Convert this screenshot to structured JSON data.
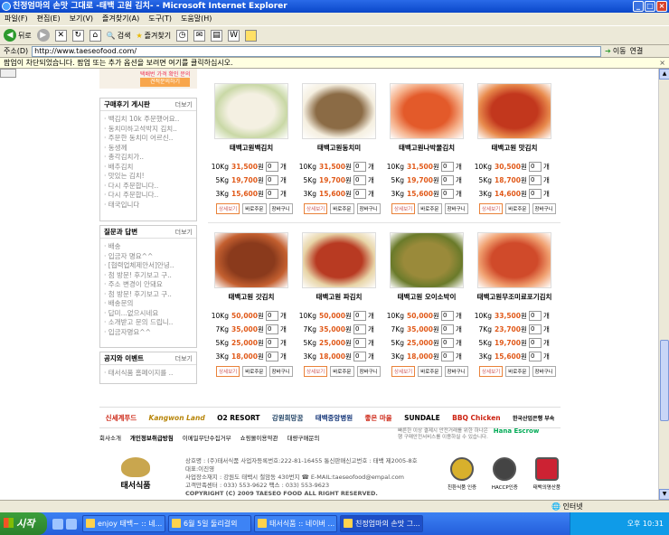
{
  "window": {
    "title": "친정엄마의 손맛 그대로 -태백 고원 김치- - Microsoft Internet Explorer"
  },
  "menu": [
    "파일(F)",
    "편집(E)",
    "보기(V)",
    "즐겨찾기(A)",
    "도구(T)",
    "도움말(H)"
  ],
  "toolbar": {
    "back": "뒤로",
    "search": "검색",
    "favorites": "즐겨찾기"
  },
  "address": {
    "label": "주소(D)",
    "url": "http://www.taeseofood.com/",
    "go": "이동",
    "links": "연결"
  },
  "popup": {
    "message": "팝업이 차단되었습니다. 팝업 또는 추가 옵션을 보려면 여기를 클릭하십시오."
  },
  "banner": {
    "button": "견적문의하기",
    "caption": "택배번 가격 확인 문의"
  },
  "reviews": {
    "title": "구매후기 게시판",
    "more": "더보기",
    "items": [
      "백김치 10k 주문했어요..",
      "동치미하고석박지 김치..",
      "주문한 동치미 어르신..",
      "동생께",
      "총각김치가..",
      "배추김치",
      "맛있는 김치!",
      "다시 주문합니다..",
      "다시 주문합니다..",
      "태국입니다"
    ]
  },
  "qna": {
    "title": "질문과 답변",
    "more": "더보기",
    "items": [
      "배송",
      "입금자 명요^^",
      "[협력업체제안서]안녕..",
      "첨 방문! 후기보고 구..",
      "주소 변경이 안돼요",
      "첨 방문! 후기보고 구..",
      "배송문의",
      "답미...없으시네요",
      "소개받고 문의 드립니..",
      "입금자명요^^"
    ]
  },
  "notice": {
    "title": "공지와 이벤트",
    "more": "더보기",
    "items": [
      "태서식품 홈페이지를 .."
    ]
  },
  "products_row1": [
    {
      "name": "태백고원백김치",
      "prices": [
        {
          "size": "10Kg",
          "price": "31,500"
        },
        {
          "size": "5Kg",
          "price": "19,700"
        },
        {
          "size": "3Kg",
          "price": "15,600"
        }
      ]
    },
    {
      "name": "태백고원동치미",
      "prices": [
        {
          "size": "10Kg",
          "price": "31,500"
        },
        {
          "size": "5Kg",
          "price": "19,700"
        },
        {
          "size": "3Kg",
          "price": "15,600"
        }
      ]
    },
    {
      "name": "태백고원나박물김치",
      "prices": [
        {
          "size": "10Kg",
          "price": "31,500"
        },
        {
          "size": "5Kg",
          "price": "19,700"
        },
        {
          "size": "3Kg",
          "price": "15,600"
        }
      ]
    },
    {
      "name": "태백고원 맛김치",
      "prices": [
        {
          "size": "10Kg",
          "price": "30,500"
        },
        {
          "size": "5Kg",
          "price": "18,700"
        },
        {
          "size": "3Kg",
          "price": "14,600"
        }
      ]
    }
  ],
  "products_row2": [
    {
      "name": "태백고원 갓김치",
      "prices": [
        {
          "size": "10Kg",
          "price": "50,000"
        },
        {
          "size": "7Kg",
          "price": "35,000"
        },
        {
          "size": "5Kg",
          "price": "25,000"
        },
        {
          "size": "3Kg",
          "price": "18,000"
        }
      ]
    },
    {
      "name": "태백고원 파김치",
      "prices": [
        {
          "size": "10Kg",
          "price": "50,000"
        },
        {
          "size": "7Kg",
          "price": "35,000"
        },
        {
          "size": "5Kg",
          "price": "25,000"
        },
        {
          "size": "3Kg",
          "price": "18,000"
        }
      ]
    },
    {
      "name": "태백고원 오이소박이",
      "prices": [
        {
          "size": "10Kg",
          "price": "50,000"
        },
        {
          "size": "7Kg",
          "price": "35,000"
        },
        {
          "size": "5Kg",
          "price": "25,000"
        },
        {
          "size": "3Kg",
          "price": "18,000"
        }
      ]
    },
    {
      "name": "태백고원무조미료포기김치",
      "prices": [
        {
          "size": "10Kg",
          "price": "33,500"
        },
        {
          "size": "7Kg",
          "price": "23,700"
        },
        {
          "size": "5Kg",
          "price": "19,700"
        },
        {
          "size": "3Kg",
          "price": "15,600"
        }
      ]
    }
  ],
  "price_suffix": {
    "won": "원",
    "unit": "개",
    "qty": "0"
  },
  "product_buttons": [
    "상세보기",
    "바로주문",
    "장바구니"
  ],
  "partners": [
    "신세계푸드",
    "Kangwon Land",
    "O2 RESORT",
    "강원희망꿈",
    "태백중앙병원",
    "좋은 마을",
    "SUNDALE",
    "BBQ Chicken",
    "한국산업은행 부속"
  ],
  "footer_links": [
    "회사소개",
    "개인정보취급방침",
    "이메일무단수집거부",
    "쇼핑몰이용약관",
    "대량구매문의"
  ],
  "escrow_note": "빠른한 이상 결제시 안전거래를 위한 하나은행 구매안전서비스를 이용하실 수 있습니다.",
  "escrow_brand": "Hana Escrow",
  "company": {
    "logo": "태서식품",
    "lines": [
      "상호명 : (주)태서식품 사업자등록번호:222-81-16455 통신판매신고번호 : 태백 제2005-8호 대표:이진영",
      "사업장소재지 : 강원도 태백시 철암동 430번지 ☎ E-MAIL:taeseofood@empal.com",
      "고객만족센터 : 033) 553-9622  팩스 : 033) 553-9623"
    ],
    "copyright": "COPYRIGHT (C) 2009 TAESEO FOOD ALL RIGHT RESERVED."
  },
  "certs": [
    "친환식품 인증",
    "HACCP인증",
    "태백의명산품"
  ],
  "status": {
    "zone": "인터넷"
  },
  "taskbar": {
    "start": "시작",
    "tasks": [
      "enjoy 태백~ :: 네...",
      "6월 5일 둘리걸외",
      "태서식품 :: 네이버 ...",
      "친정엄마의 손맛 그..."
    ],
    "clock": "오후 10:31"
  }
}
